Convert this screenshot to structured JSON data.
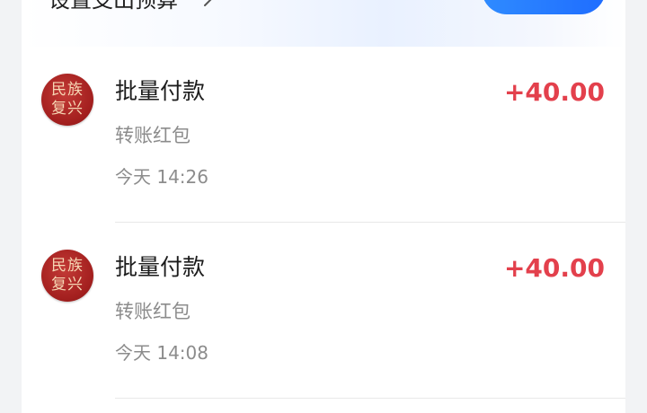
{
  "budget_banner": {
    "text": "设置支出预算"
  },
  "transactions": [
    {
      "avatar_line1": "民族",
      "avatar_line2": "复兴",
      "title": "批量付款",
      "subtitle": "转账红包",
      "time": "今天 14:26",
      "amount": "+40.00"
    },
    {
      "avatar_line1": "民族",
      "avatar_line2": "复兴",
      "title": "批量付款",
      "subtitle": "转账红包",
      "time": "今天 14:08",
      "amount": "+40.00"
    }
  ],
  "colors": {
    "amount": "#e3404c",
    "accent": "#1f6dff",
    "avatar": "#a4201f"
  }
}
